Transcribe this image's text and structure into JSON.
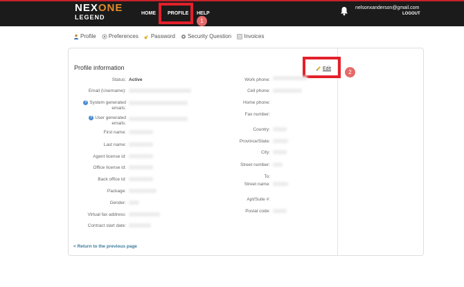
{
  "header": {
    "logo_part1": "NEX",
    "logo_part2": "ONE",
    "logo_sub": "LEGEND",
    "nav": {
      "home": "HOME",
      "profile": "PROFILE",
      "help": "HELP"
    },
    "user_email": "nelsonxanderson@gmail.com",
    "logout": "LOGOUT"
  },
  "annotations": {
    "step1": "1",
    "step2": "2"
  },
  "subnav": {
    "profile": "Profile",
    "preferences": "Preferences",
    "password": "Password",
    "security": "Security Question",
    "invoices": "Invoices"
  },
  "panel": {
    "title": "Profile information",
    "edit": "Edit",
    "left_fields": {
      "status": "Status:",
      "status_value": "Active",
      "email": "Email (Username):",
      "sys_emails_1": "System generated",
      "sys_emails_2": "emails:",
      "user_emails_1": "User generated",
      "user_emails_2": "emails:",
      "first_name": "First name:",
      "last_name": "Last name:",
      "agent_license": "Agent license id:",
      "office_license": "Office license id:",
      "back_office": "Back office Id:",
      "package": "Package:",
      "gender": "Gender:",
      "virtual_fax": "Virtual fax address:",
      "contract_start": "Contract start date:"
    },
    "right_fields": {
      "work_phone": "Work phone:",
      "cell_phone": "Cell phone:",
      "home_phone": "Home phone:",
      "fax": "Fax number:",
      "country": "Country:",
      "province": "Province/State:",
      "city": "City:",
      "street_number": "Street number:",
      "to": "To:",
      "street_name": "Street name:",
      "apt": "Apt/Suite #:",
      "postal": "Postal code:"
    },
    "back_link": "< Return to the previous page"
  }
}
